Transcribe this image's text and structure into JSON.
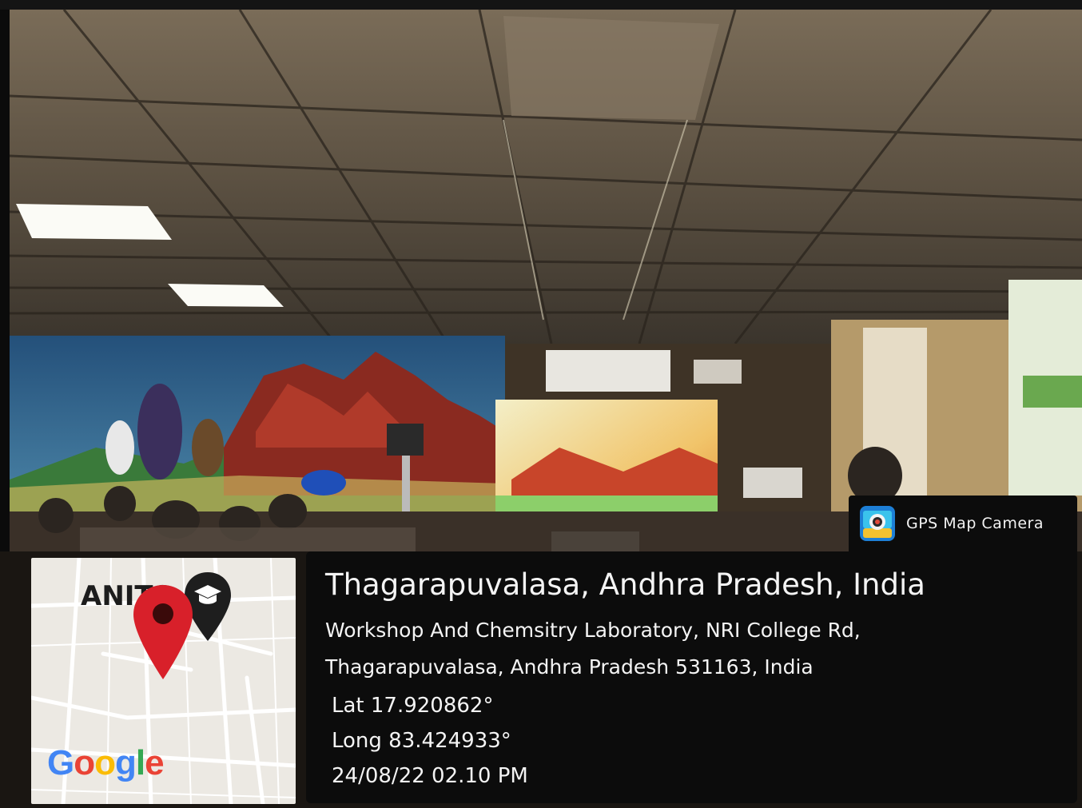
{
  "photo": {
    "scene": "classroom-with-projector"
  },
  "badge": {
    "app_name": "GPS Map Camera",
    "icon": "gps-map-camera-icon"
  },
  "location": {
    "title": "Thagarapuvalasa, Andhra Pradesh, India",
    "address_line1": "Workshop And Chemsitry Laboratory, NRI College Rd,",
    "address_line2": "Thagarapuvalasa, Andhra Pradesh 531163, India",
    "lat": "Lat 17.920862°",
    "long": "Long 83.424933°",
    "datetime": "24/08/22  02.10 PM"
  },
  "map": {
    "place_label": "ANITS",
    "google": [
      "G",
      "o",
      "o",
      "g",
      "l",
      "e"
    ],
    "google_colors": [
      "#4285F4",
      "#EA4335",
      "#FBBC05",
      "#4285F4",
      "#34A853",
      "#EA4335"
    ],
    "pin_color": "#D8202A",
    "icons": [
      "location-pin-icon",
      "graduation-cap-icon"
    ]
  },
  "colors": {
    "panel": "#0c0c0c",
    "text": "#f4f4f4",
    "ceiling": "#6c6050",
    "wall_mural_sky": "#2f5e86"
  }
}
